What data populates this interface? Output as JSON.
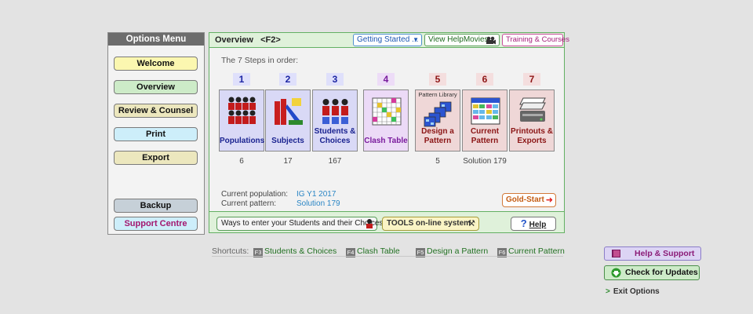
{
  "options_menu": {
    "title": "Options Menu",
    "items": [
      {
        "label": "Welcome"
      },
      {
        "label": "Overview"
      },
      {
        "label": "Review & Counsel"
      },
      {
        "label": "Print"
      },
      {
        "label": "Export"
      },
      {
        "label": "Backup"
      },
      {
        "label": "Support Centre"
      }
    ]
  },
  "overview": {
    "title": "Overview   <F2>",
    "getting_started": "Getting Started ...",
    "help_movies": "View HelpMovies",
    "training": "Training & Courses",
    "steps_caption": "The 7 Steps in order:",
    "steps": [
      {
        "num": "1",
        "label": "Populations",
        "count": "6"
      },
      {
        "num": "2",
        "label": "Subjects",
        "count": "17"
      },
      {
        "num": "3",
        "label": "Students & Choices",
        "count": "167"
      },
      {
        "num": "4",
        "label": "Clash Table",
        "count": ""
      },
      {
        "num": "5",
        "label": "Design a Pattern",
        "count": "5",
        "sublabel": "Pattern Library"
      },
      {
        "num": "6",
        "label": "Current Pattern",
        "count": "Solution 179"
      },
      {
        "num": "7",
        "label": "Printouts & Exports",
        "count": ""
      }
    ],
    "current_population_label": "Current population:",
    "current_population_value": "IG Y1 2017",
    "current_pattern_label": "Current pattern:",
    "current_pattern_value": "Solution 179",
    "gold_start": "Gold-Start",
    "ways_button": "Ways to enter your Students and their Choices",
    "tools_button": "TOOLS on-line system",
    "help_button": "Help"
  },
  "shortcuts": {
    "label": "Shortcuts:",
    "items": [
      {
        "key": "F3",
        "label": "Students & Choices"
      },
      {
        "key": "F4",
        "label": "Clash Table"
      },
      {
        "key": "F5",
        "label": "Design a Pattern"
      },
      {
        "key": "F6",
        "label": "Current Pattern"
      }
    ]
  },
  "help_support": "Help & Support",
  "check_updates": "Check for Updates",
  "exit_options": "Exit Options"
}
